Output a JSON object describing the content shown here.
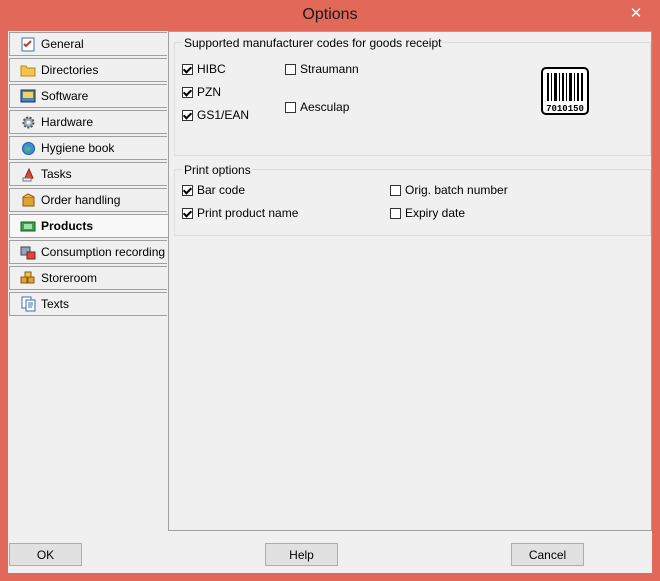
{
  "window": {
    "title": "Options"
  },
  "tabs": [
    {
      "label": "General",
      "icon": "checklist-icon"
    },
    {
      "label": "Directories",
      "icon": "folder-icon"
    },
    {
      "label": "Software",
      "icon": "software-icon"
    },
    {
      "label": "Hardware",
      "icon": "gear-icon"
    },
    {
      "label": "Hygiene book",
      "icon": "globe-icon"
    },
    {
      "label": "Tasks",
      "icon": "tasks-icon"
    },
    {
      "label": "Order handling",
      "icon": "package-icon"
    },
    {
      "label": "Products",
      "icon": "products-icon",
      "active": true
    },
    {
      "label": "Consumption recording",
      "icon": "consumption-icon"
    },
    {
      "label": "Storeroom",
      "icon": "storeroom-icon"
    },
    {
      "label": "Texts",
      "icon": "documents-icon"
    }
  ],
  "supported": {
    "label": "Supported manufacturer codes for goods receipt",
    "items": [
      {
        "label": "HIBC",
        "checked": true
      },
      {
        "label": "PZN",
        "checked": true
      },
      {
        "label": "GS1/EAN",
        "checked": true
      },
      {
        "label": "Straumann",
        "checked": false
      },
      {
        "label": "Aesculap",
        "checked": false
      }
    ],
    "barcode_text": "7010150"
  },
  "print": {
    "label": "Print options",
    "items": [
      {
        "label": "Bar code",
        "checked": true
      },
      {
        "label": "Print product name",
        "checked": true
      },
      {
        "label": "Orig. batch number",
        "checked": false
      },
      {
        "label": "Expiry date",
        "checked": false
      }
    ]
  },
  "buttons": {
    "ok": "OK",
    "help": "Help",
    "cancel": "Cancel"
  },
  "colors": {
    "frame": "#e2685a",
    "client": "#f0f0f0"
  }
}
